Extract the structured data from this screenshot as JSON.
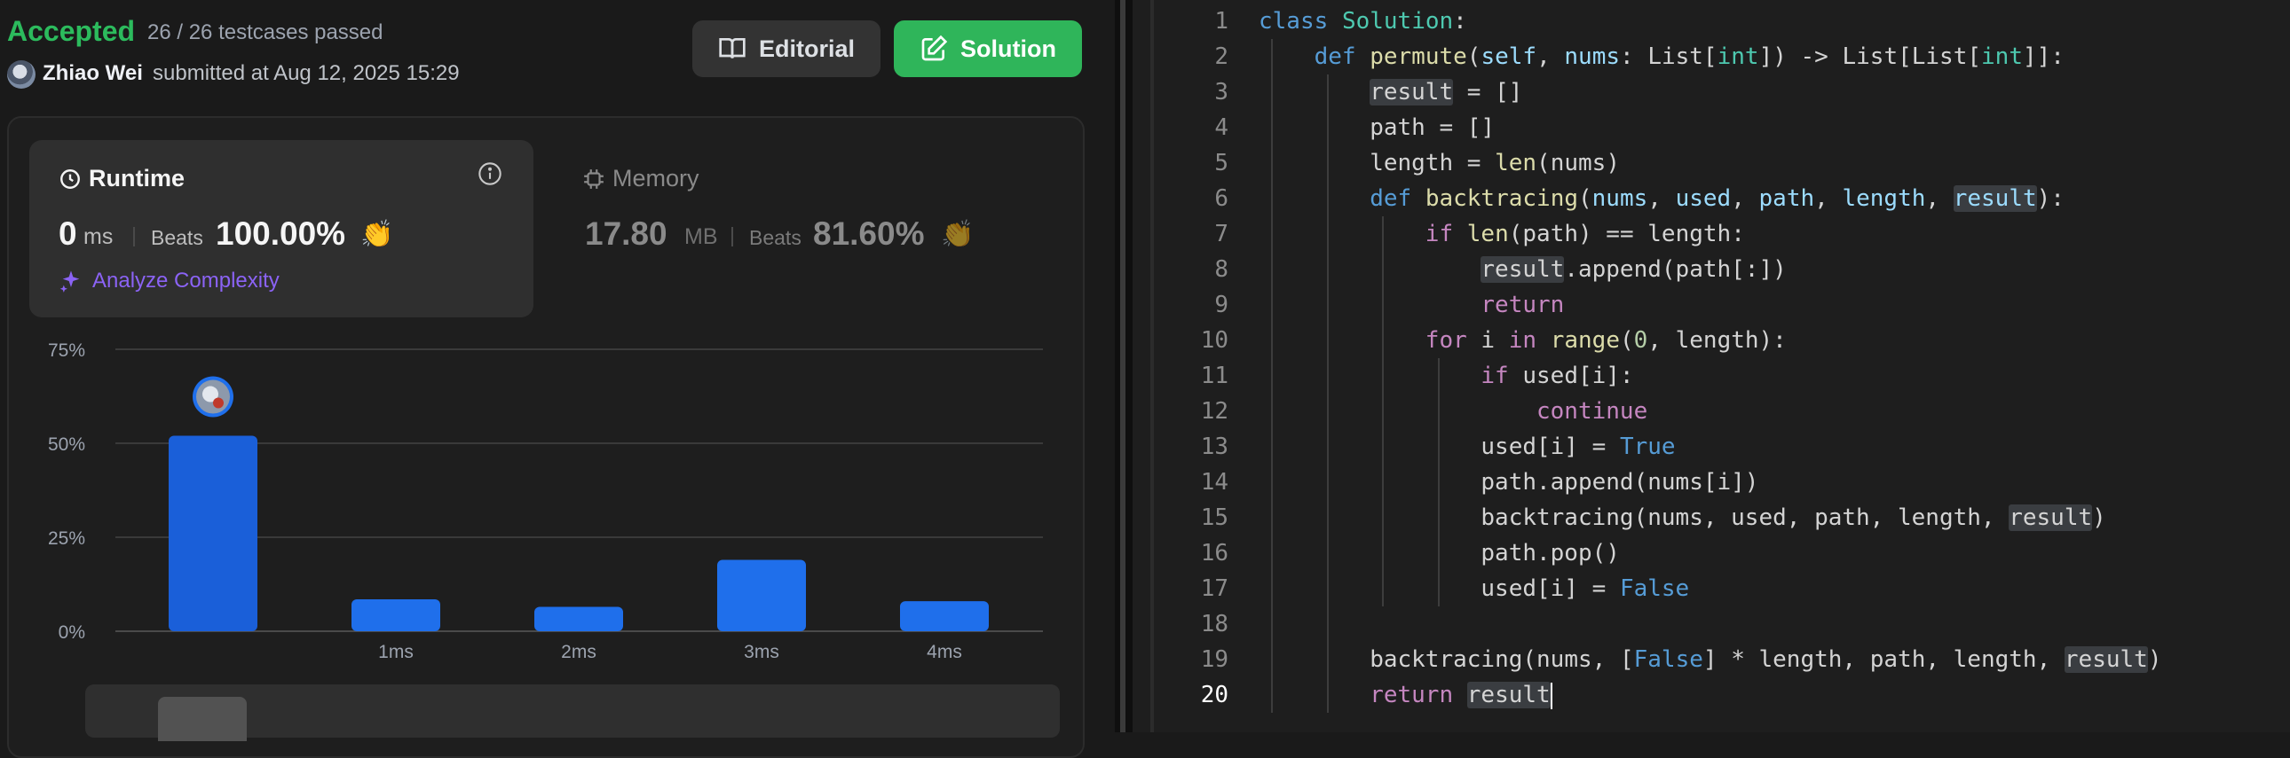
{
  "submission": {
    "status": "Accepted",
    "testcases": "26 / 26 testcases passed",
    "author": "Zhiao Wei",
    "submitted_at": "submitted at Aug 12, 2025 15:29",
    "editorial_label": "Editorial",
    "solution_label": "Solution"
  },
  "runtime": {
    "title": "Runtime",
    "value": "0",
    "unit": "ms",
    "beats_label": "Beats",
    "beats_value": "100.00%",
    "analyze_label": "Analyze Complexity"
  },
  "memory": {
    "title": "Memory",
    "value": "17.80",
    "unit": "MB",
    "beats_label": "Beats",
    "beats_value": "81.60%"
  },
  "colors": {
    "accepted": "#2cbb5d",
    "bar": "#1f6feb",
    "accent_purple": "#8b63f5"
  },
  "chart_data": {
    "type": "bar",
    "categories": [
      "0ms",
      "1ms",
      "2ms",
      "3ms",
      "4ms"
    ],
    "tick_labels": [
      "",
      "1ms",
      "2ms",
      "3ms",
      "4ms"
    ],
    "values": [
      52,
      8.5,
      6.5,
      19,
      8
    ],
    "ylim": [
      0,
      75
    ],
    "yticks": [
      "0%",
      "25%",
      "50%",
      "75%"
    ],
    "ytick_values": [
      0,
      25,
      50,
      75
    ],
    "grid": true,
    "highlight_category": "0ms"
  },
  "editor": {
    "active_line": 20,
    "lines": [
      {
        "n": "1",
        "indent": 0,
        "html": "<span class=\"kw\">class</span> <span class=\"cls\">Solution</span>:"
      },
      {
        "n": "2",
        "indent": 1,
        "html": "<span class=\"kw\">def</span> <span class=\"fn\">permute</span>(<span class=\"prm\">self</span>, <span class=\"prm\">nums</span>: List[<span class=\"cls\">int</span>]) -> List[List[<span class=\"cls\">int</span>]]:"
      },
      {
        "n": "3",
        "indent": 2,
        "html": "<span class=\"hl\">result</span> = []"
      },
      {
        "n": "4",
        "indent": 2,
        "html": "path = []"
      },
      {
        "n": "5",
        "indent": 2,
        "html": "length = <span class=\"fn\">len</span>(nums)"
      },
      {
        "n": "6",
        "indent": 2,
        "html": "<span class=\"kw\">def</span> <span class=\"fn\">backtracing</span>(<span class=\"prm\">nums</span>, <span class=\"prm\">used</span>, <span class=\"prm\">path</span>, <span class=\"prm\">length</span>, <span class=\"prm hl\">result</span>):"
      },
      {
        "n": "7",
        "indent": 3,
        "html": "<span class=\"ctl\">if</span> <span class=\"fn\">len</span>(path) == length:"
      },
      {
        "n": "8",
        "indent": 4,
        "html": "<span class=\"hl\">result</span>.append(path[:])"
      },
      {
        "n": "9",
        "indent": 4,
        "html": "<span class=\"ctl\">return</span>"
      },
      {
        "n": "10",
        "indent": 3,
        "html": "<span class=\"ctl\">for</span> i <span class=\"ctl\">in</span> <span class=\"fn\">range</span>(<span class=\"num\">0</span>, length):"
      },
      {
        "n": "11",
        "indent": 4,
        "html": "<span class=\"ctl\">if</span> used[i]:"
      },
      {
        "n": "12",
        "indent": 5,
        "html": "<span class=\"ctl\">continue</span>"
      },
      {
        "n": "13",
        "indent": 4,
        "html": "used[i] = <span class=\"cnst\">True</span>"
      },
      {
        "n": "14",
        "indent": 4,
        "html": "path.append(nums[i])"
      },
      {
        "n": "15",
        "indent": 4,
        "html": "backtracing(nums, used, path, length, <span class=\"hl\">result</span>)"
      },
      {
        "n": "16",
        "indent": 4,
        "html": "path.pop()"
      },
      {
        "n": "17",
        "indent": 4,
        "html": "used[i] = <span class=\"cnst\">False</span>"
      },
      {
        "n": "18",
        "indent": 0,
        "html": ""
      },
      {
        "n": "19",
        "indent": 2,
        "html": "backtracing(nums, [<span class=\"cnst\">False</span>] * length, path, length, <span class=\"hl\">result</span>)"
      },
      {
        "n": "20",
        "indent": 2,
        "html": "<span class=\"ctl\">return</span> <span class=\"hl\">result</span><span class=\"cursor\"></span>"
      }
    ]
  }
}
